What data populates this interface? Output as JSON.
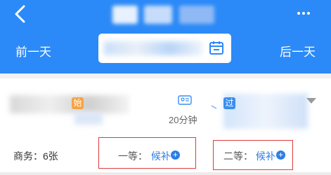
{
  "header": {
    "prev_day_label": "前一天",
    "next_day_label": "后一天",
    "bg_color": "#2b8af7"
  },
  "train": {
    "from_badge": "始",
    "to_badge": "过",
    "duration": "20分钟"
  },
  "seats": {
    "business": "商务：6张",
    "first_class_label": "一等：",
    "first_class_status": "候补",
    "second_class_label": "二等：",
    "second_class_status": "候补",
    "plus_symbol": "+"
  }
}
